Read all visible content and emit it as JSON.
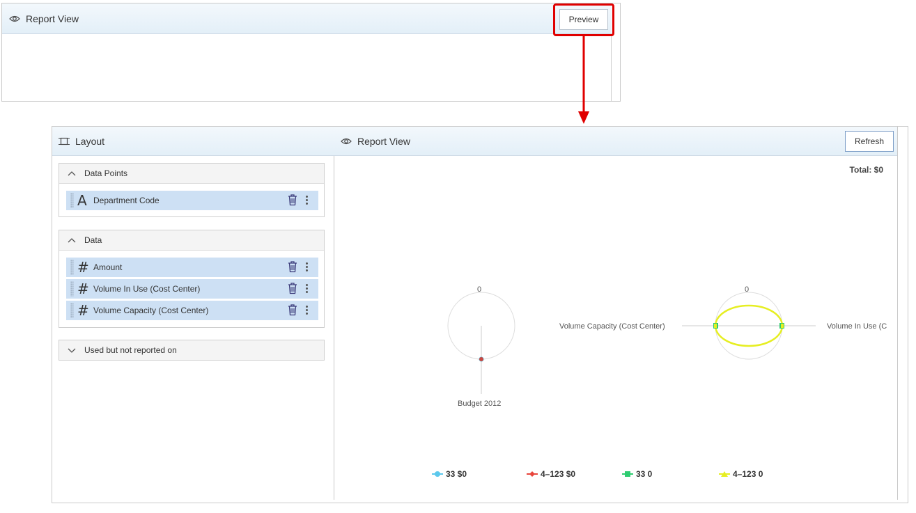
{
  "preview_panel": {
    "title": "Report View",
    "preview_button": "Preview"
  },
  "layout_pane": {
    "title": "Layout",
    "sections": [
      {
        "title": "Data Points",
        "expanded": true,
        "fields": [
          {
            "type_icon": "A",
            "label": "Department Code"
          }
        ]
      },
      {
        "title": "Data",
        "expanded": true,
        "fields": [
          {
            "type_icon": "#",
            "label": "Amount"
          },
          {
            "type_icon": "#",
            "label": "Volume In Use (Cost Center)"
          },
          {
            "type_icon": "#",
            "label": "Volume Capacity (Cost Center)"
          }
        ]
      },
      {
        "title": "Used but not reported on",
        "expanded": false,
        "fields": []
      }
    ]
  },
  "report_pane": {
    "title": "Report View",
    "refresh_button": "Refresh",
    "total": "Total: $0"
  },
  "chart_data": [
    {
      "type": "radar",
      "axes": [
        "Budget 2012"
      ],
      "tick_labels": [
        "0"
      ],
      "series": [
        {
          "name": "33 $0",
          "values": [
            0
          ],
          "color": "#5bc8ec"
        },
        {
          "name": "4-123 $0",
          "values": [
            0
          ],
          "color": "#e8453c"
        }
      ]
    },
    {
      "type": "radar",
      "axes": [
        "Volume In Use (C",
        "Volume Capacity (Cost Center)"
      ],
      "tick_labels": [
        "0"
      ],
      "series": [
        {
          "name": "33 0",
          "values": [
            0,
            0
          ],
          "color": "#2ecc71"
        },
        {
          "name": "4-123 0",
          "values": [
            0,
            0
          ],
          "color": "#e6ee22"
        }
      ]
    }
  ],
  "legend": [
    {
      "label": "33 $0",
      "color": "#5bc8ec",
      "marker": "circle"
    },
    {
      "label": "4–123 $0",
      "color": "#e8453c",
      "marker": "diamond"
    },
    {
      "label": "33 0",
      "color": "#2ecc71",
      "marker": "square"
    },
    {
      "label": "4–123 0",
      "color": "#e6ee22",
      "marker": "triangle"
    }
  ],
  "colors": {
    "highlight": "#e00000",
    "header_bg": "#e3eff8",
    "row_bg": "#cde0f4"
  },
  "icons": [
    "eye-icon",
    "layout-icon",
    "chevron-up-icon",
    "chevron-down-icon",
    "text-type-icon",
    "number-type-icon",
    "trash-icon",
    "more-vertical-icon",
    "drag-handle-icon",
    "arrow-down-icon"
  ]
}
